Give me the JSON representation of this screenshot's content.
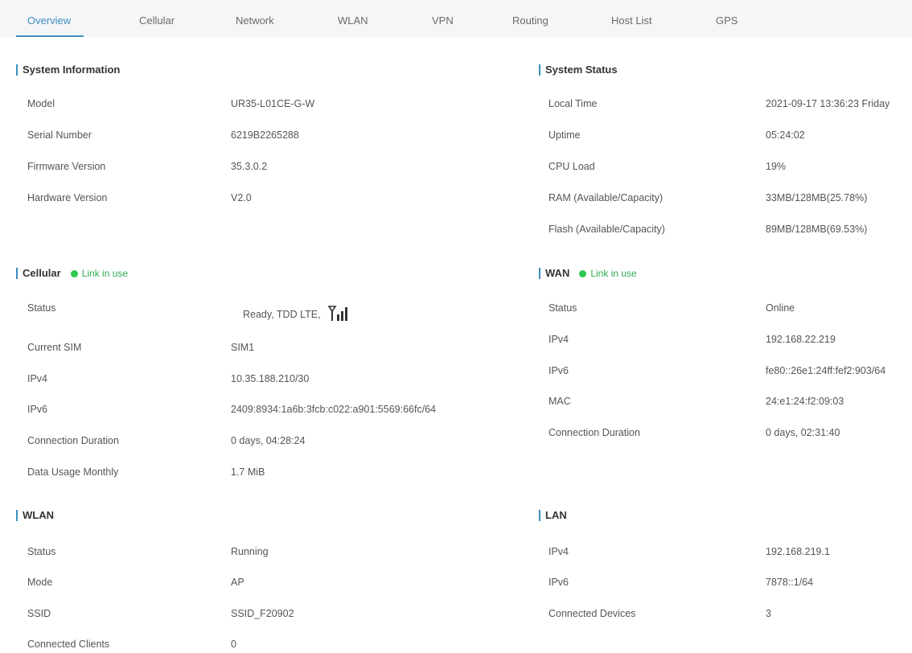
{
  "tabs": [
    {
      "label": "Overview",
      "active": true
    },
    {
      "label": "Cellular"
    },
    {
      "label": "Network"
    },
    {
      "label": "WLAN"
    },
    {
      "label": "VPN"
    },
    {
      "label": "Routing"
    },
    {
      "label": "Host List"
    },
    {
      "label": "GPS"
    }
  ],
  "system_info": {
    "title": "System Information",
    "rows": [
      {
        "label": "Model",
        "value": "UR35-L01CE-G-W"
      },
      {
        "label": "Serial Number",
        "value": "6219B2265288"
      },
      {
        "label": "Firmware Version",
        "value": "35.3.0.2"
      },
      {
        "label": "Hardware Version",
        "value": "V2.0"
      }
    ]
  },
  "system_status": {
    "title": "System Status",
    "rows": [
      {
        "label": "Local Time",
        "value": "2021-09-17 13:36:23 Friday"
      },
      {
        "label": "Uptime",
        "value": "05:24:02"
      },
      {
        "label": "CPU Load",
        "value": "19%"
      },
      {
        "label": "RAM (Available/Capacity)",
        "value": "33MB/128MB(25.78%)"
      },
      {
        "label": "Flash (Available/Capacity)",
        "value": "89MB/128MB(69.53%)"
      }
    ]
  },
  "cellular": {
    "title": "Cellular",
    "badge": "Link in use",
    "signal_icon": "signal-strength-icon",
    "rows": [
      {
        "label": "Status",
        "value": "Ready, TDD LTE,"
      },
      {
        "label": "Current SIM",
        "value": "SIM1"
      },
      {
        "label": "IPv4",
        "value": "10.35.188.210/30"
      },
      {
        "label": "IPv6",
        "value": "2409:8934:1a6b:3fcb:c022:a901:5569:66fc/64"
      },
      {
        "label": "Connection Duration",
        "value": "0 days, 04:28:24"
      },
      {
        "label": "Data Usage Monthly",
        "value": "1.7 MiB"
      }
    ]
  },
  "wan": {
    "title": "WAN",
    "badge": "Link in use",
    "rows": [
      {
        "label": "Status",
        "value": "Online"
      },
      {
        "label": "IPv4",
        "value": "192.168.22.219"
      },
      {
        "label": "IPv6",
        "value": "fe80::26e1:24ff:fef2:903/64"
      },
      {
        "label": "MAC",
        "value": "24:e1:24:f2:09:03"
      },
      {
        "label": "Connection Duration",
        "value": "0 days, 02:31:40"
      }
    ]
  },
  "wlan": {
    "title": "WLAN",
    "rows": [
      {
        "label": "Status",
        "value": "Running"
      },
      {
        "label": "Mode",
        "value": "AP"
      },
      {
        "label": "SSID",
        "value": "SSID_F20902"
      },
      {
        "label": "Connected Clients",
        "value": "0"
      }
    ]
  },
  "lan": {
    "title": "LAN",
    "rows": [
      {
        "label": "IPv4",
        "value": "192.168.219.1"
      },
      {
        "label": "IPv6",
        "value": "7878::1/64"
      },
      {
        "label": "Connected Devices",
        "value": "3"
      }
    ]
  },
  "colors": {
    "accent": "#3c8dbc",
    "link_green": "#2dc84d",
    "tab_bar_bg": "#f5f6f8"
  }
}
